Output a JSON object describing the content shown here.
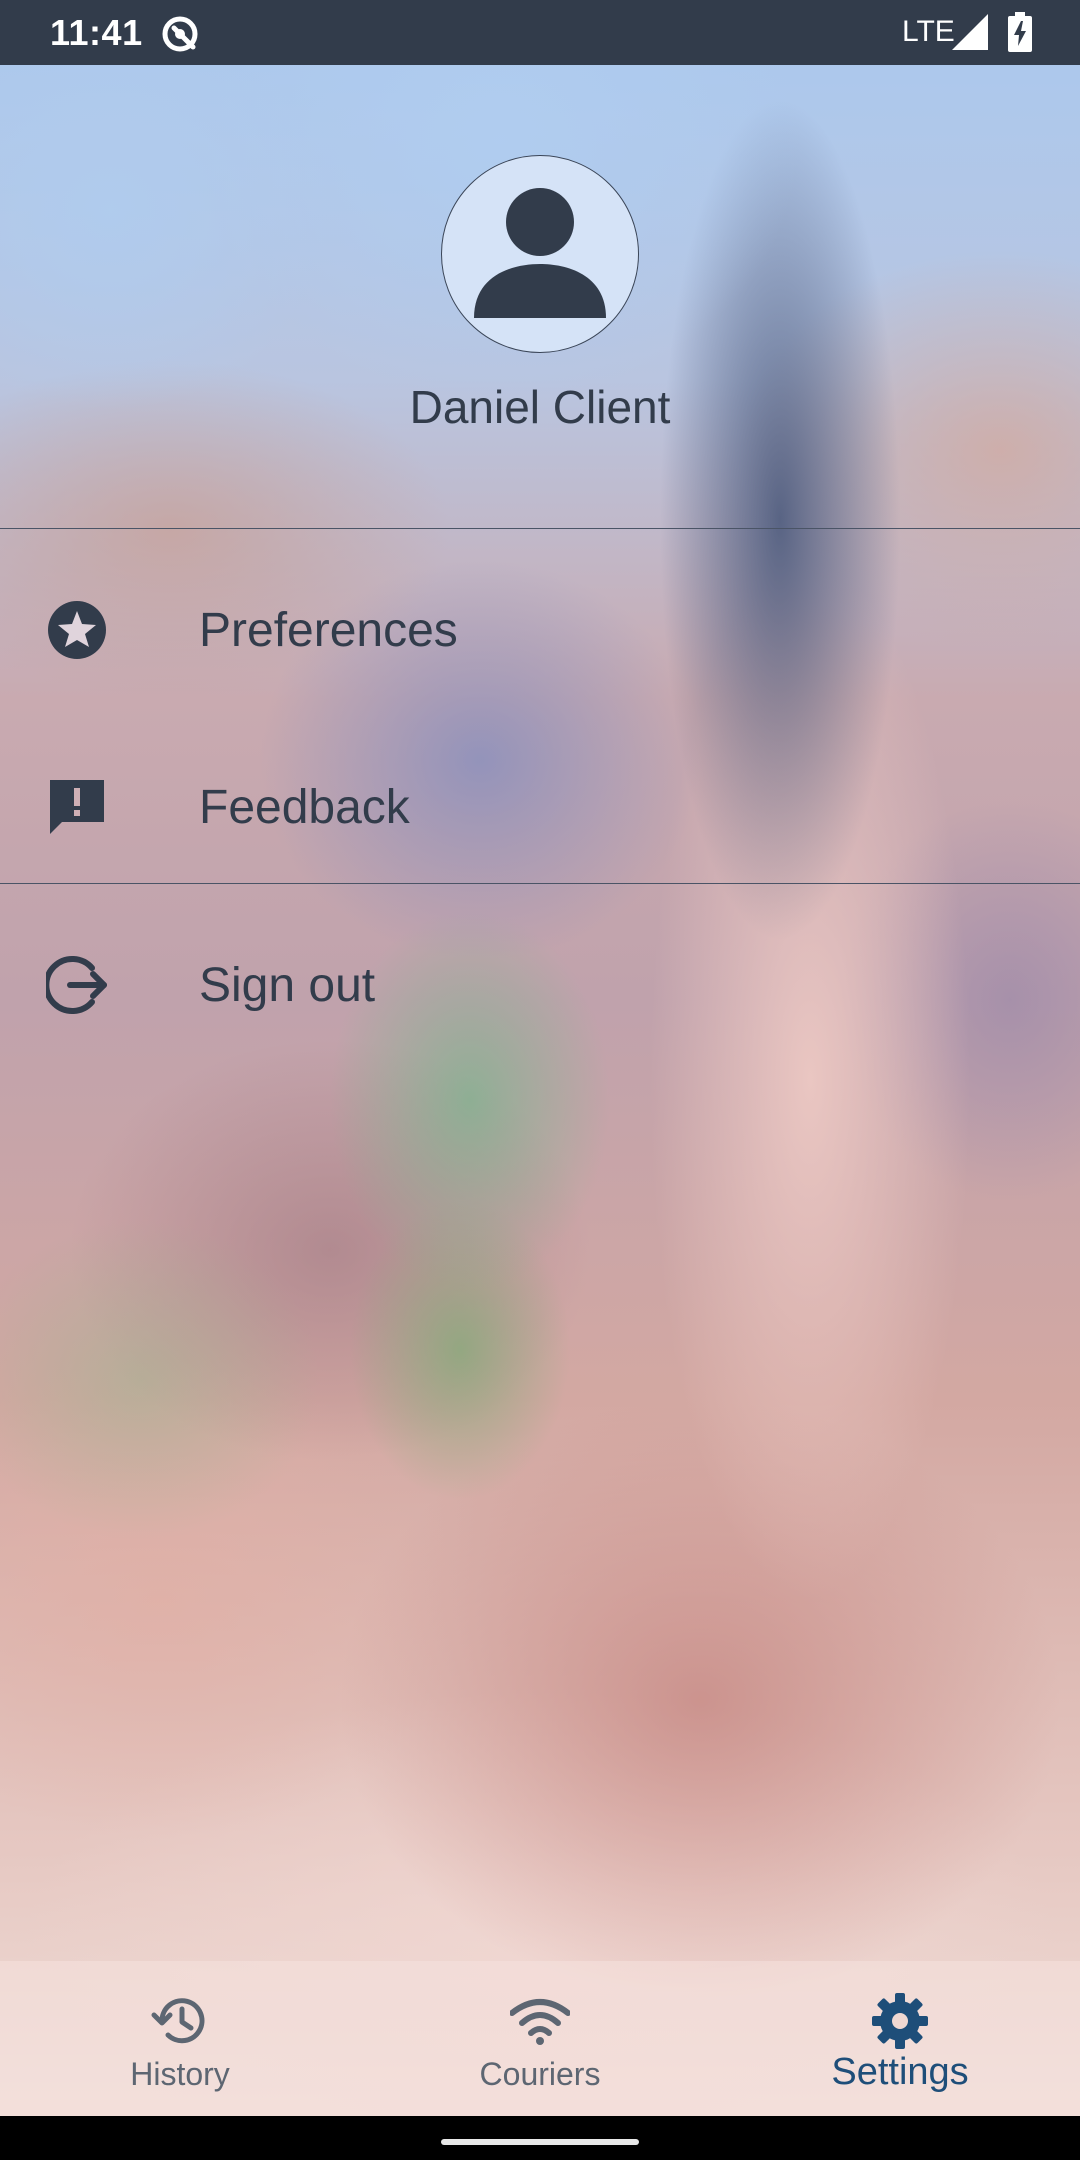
{
  "status_bar": {
    "time": "11:41",
    "network": "LTE",
    "icons": [
      "app-notification-icon",
      "signal-icon",
      "battery-charging-icon"
    ]
  },
  "profile": {
    "name": "Daniel Client",
    "avatar_icon": "person-icon"
  },
  "menu": {
    "items": [
      {
        "label": "Preferences",
        "icon": "star-circle-icon"
      },
      {
        "label": "Feedback",
        "icon": "feedback-icon"
      },
      {
        "label": "Sign out",
        "icon": "logout-icon"
      }
    ]
  },
  "bottom_nav": {
    "tabs": [
      {
        "label": "History",
        "icon": "history-icon",
        "active": false
      },
      {
        "label": "Couriers",
        "icon": "wifi-icon",
        "active": false
      },
      {
        "label": "Settings",
        "icon": "gear-icon",
        "active": true
      }
    ]
  },
  "colors": {
    "status_bar": "#323c4b",
    "text_primary": "#323c4b",
    "active_tab": "#1e4e79",
    "inactive_tab": "#5d6672",
    "avatar_background": "#d5e3f7"
  }
}
